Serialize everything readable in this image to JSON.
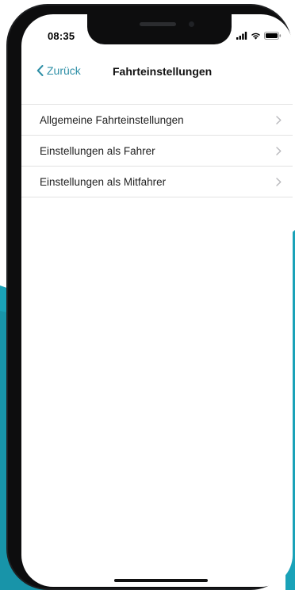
{
  "status_bar": {
    "time": "08:35"
  },
  "nav": {
    "back_label": "Zurück",
    "title": "Fahrteinstellungen"
  },
  "menu_items": [
    {
      "label": "Allgemeine Fahrteinstellungen"
    },
    {
      "label": "Einstellungen als Fahrer"
    },
    {
      "label": "Einstellungen als Mitfahrer"
    }
  ],
  "colors": {
    "accent": "#2e8fa6",
    "background_wave": "#1aa2b8",
    "phone_frame": "#1e1f21"
  },
  "icons": {
    "back": "chevron-left-icon",
    "row_arrow": "chevron-right-icon",
    "signal": "signal-icon",
    "wifi": "wifi-icon",
    "battery": "battery-icon"
  }
}
